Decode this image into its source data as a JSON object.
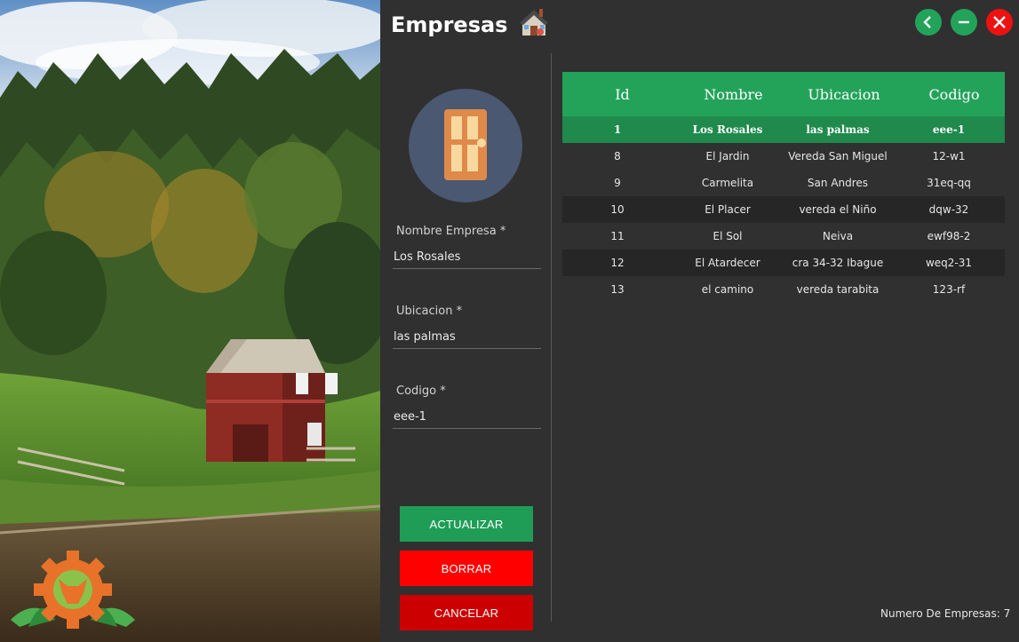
{
  "window": {
    "title": "Empresas",
    "back_icon": "chevron-left-icon",
    "minimize_icon": "minus-icon",
    "close_icon": "close-icon"
  },
  "form": {
    "name_label": "Nombre Empresa *",
    "name_value": "Los Rosales",
    "location_label": "Ubicacion *",
    "location_value": "las palmas",
    "code_label": "Codigo *",
    "code_value": "eee-1"
  },
  "actions": {
    "update": "ACTUALIZAR",
    "delete": "BORRAR",
    "cancel": "CANCELAR"
  },
  "table": {
    "headers": [
      "Id",
      "Nombre",
      "Ubicacion",
      "Codigo"
    ],
    "rows": [
      {
        "id": "1",
        "name": "Los Rosales",
        "location": "las palmas",
        "code": "eee-1"
      },
      {
        "id": "8",
        "name": "El Jardin",
        "location": "Vereda San Miguel",
        "code": "12-w1"
      },
      {
        "id": "9",
        "name": "Carmelita",
        "location": "San Andres",
        "code": "31eq-qq"
      },
      {
        "id": "10",
        "name": "El Placer",
        "location": "vereda el Niño",
        "code": "dqw-32"
      },
      {
        "id": "11",
        "name": "El Sol",
        "location": "Neiva",
        "code": "ewf98-2"
      },
      {
        "id": "12",
        "name": "El Atardecer",
        "location": "cra 34-32 Ibague",
        "code": "weq2-31"
      },
      {
        "id": "13",
        "name": "el camino",
        "location": "vereda tarabita",
        "code": "123-rf"
      }
    ]
  },
  "footer": {
    "count_text": "Numero De Empresas: 7"
  },
  "colors": {
    "accent_green": "#23a35a",
    "selected_row": "#1f8a4c",
    "delete_red": "#ff0000",
    "cancel_red": "#cc0000",
    "background": "#303030"
  }
}
